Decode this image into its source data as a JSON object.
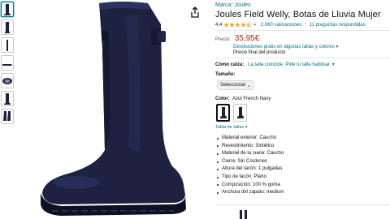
{
  "product": {
    "brand": "Marca: Joules",
    "title": "Joules Field Welly, Botas de Lluvia Mujer",
    "rating_value": "4,4",
    "ratings_count": "2.060 valoraciones",
    "questions": "11 preguntas respondidas"
  },
  "price": {
    "label": "Precio:",
    "value": "35,95€",
    "returns": "Devoluciones gratis en algunas tallas y colores",
    "final": "Precio final del producto"
  },
  "fit": {
    "label": "Cómo calza:",
    "value": "La talla coincide. Pide tu talla habitual."
  },
  "size": {
    "label": "Tamaño:",
    "selected": "Seleccionar"
  },
  "color": {
    "label": "Color:",
    "value": "Azul French Navy"
  },
  "size_table": "Tabla de tallas",
  "specs": [
    "Material exterior: Caucho",
    "Revestimiento: Sintético",
    "Material de la suela: Caucho",
    "Cierre: Sin Cordones",
    "Altura del tacón: 1 pulgadas",
    "Tipo de tacón: Plano",
    "Composición: 100 % goma",
    "Anchura del zapato: medium"
  ],
  "colors": {
    "boot_navy": "#1d2240",
    "link": "#007185",
    "price": "#B12704",
    "star": "#FFA41C"
  },
  "icons": [
    "share-icon",
    "star-icon",
    "chevron-down-icon"
  ]
}
